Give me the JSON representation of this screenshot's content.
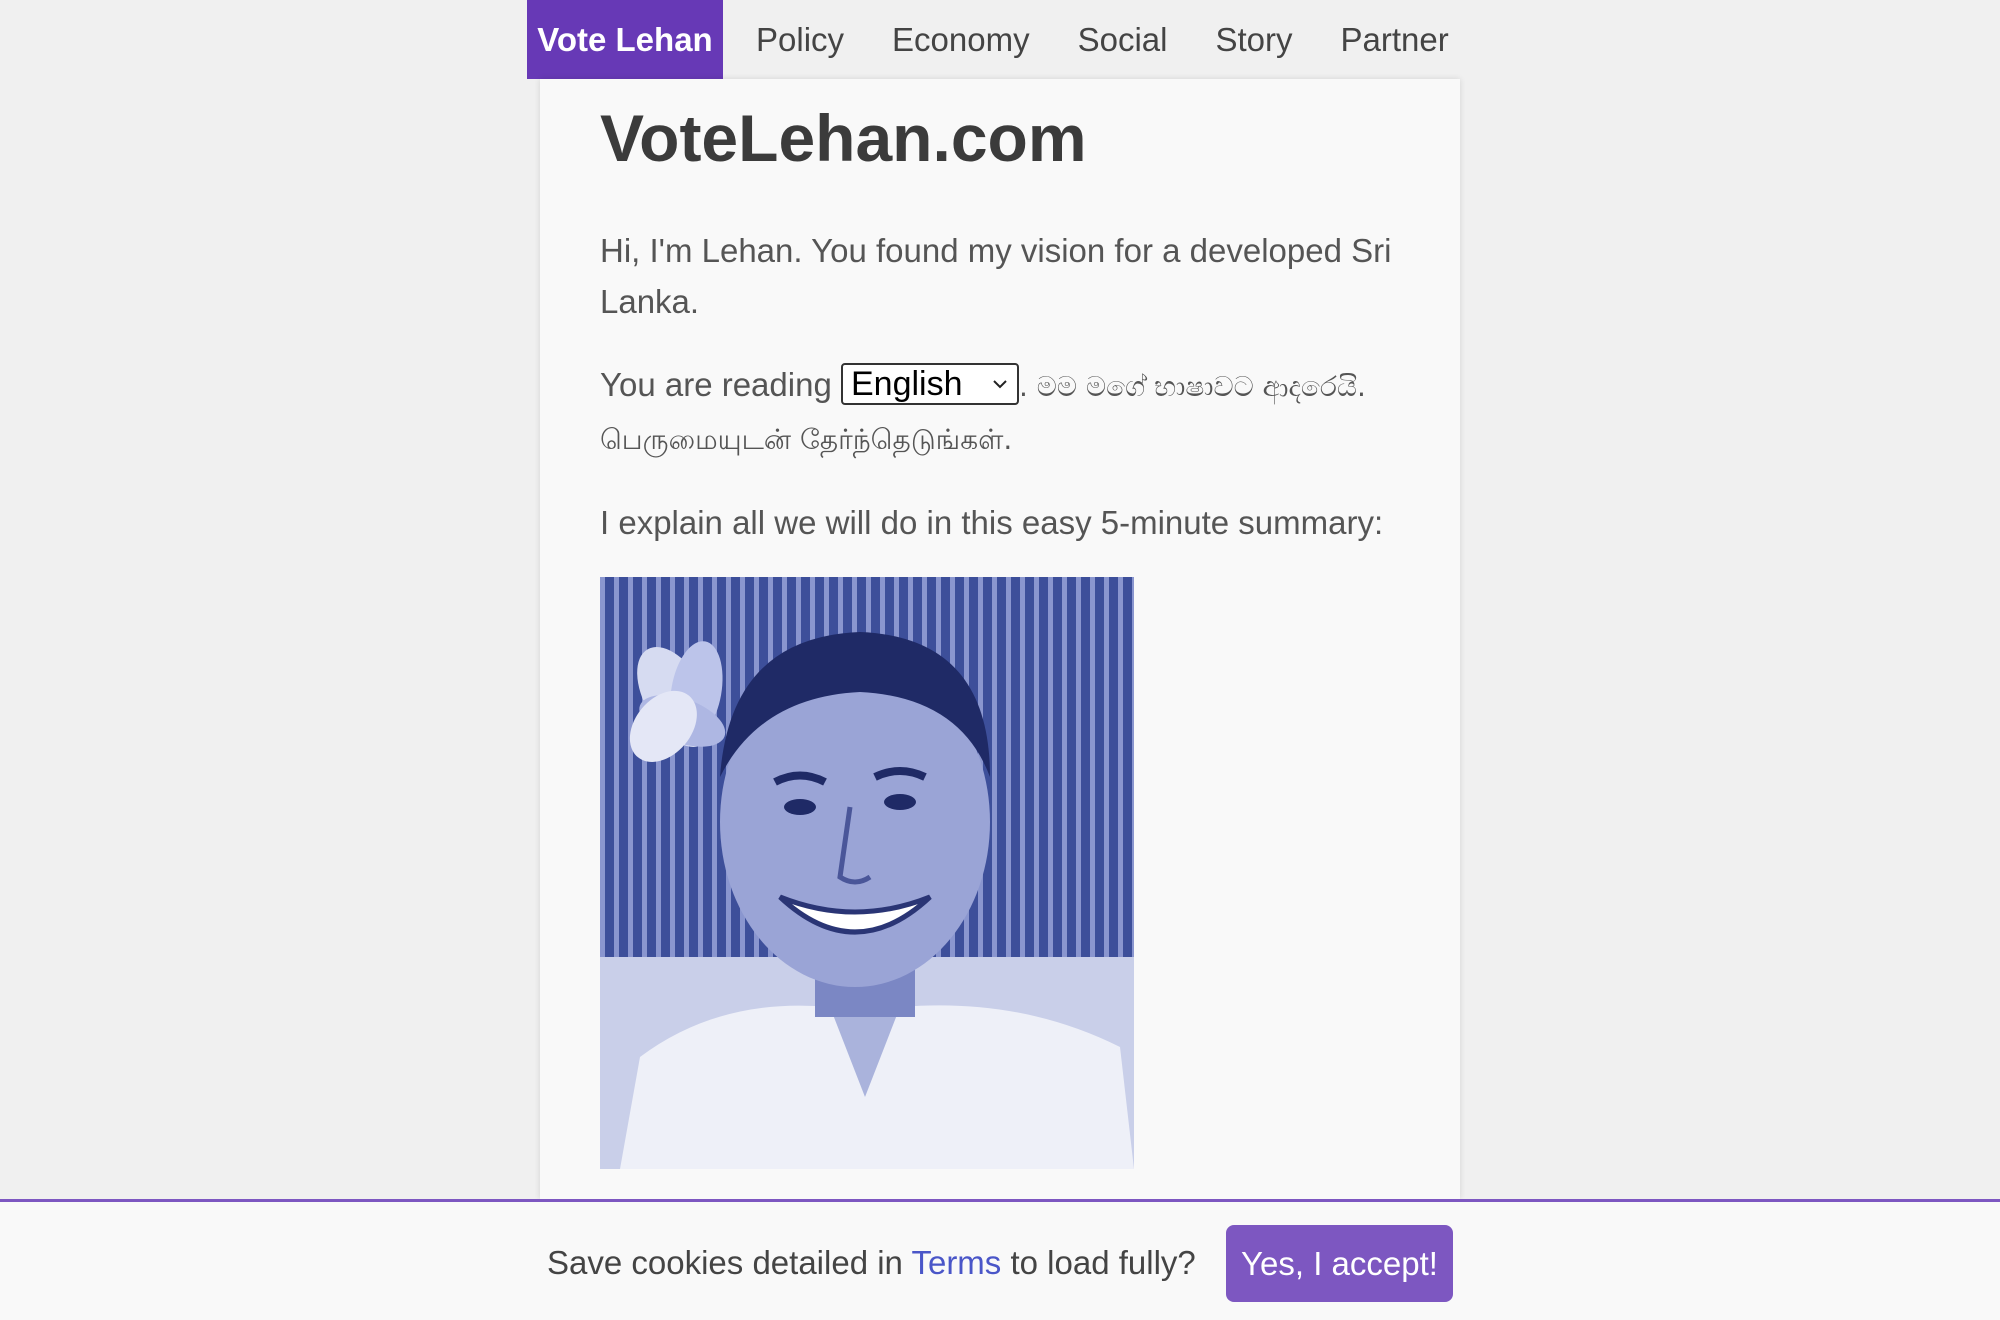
{
  "nav": {
    "brand": "Vote Lehan",
    "items": [
      {
        "label": "Policy"
      },
      {
        "label": "Economy"
      },
      {
        "label": "Social"
      },
      {
        "label": "Story"
      },
      {
        "label": "Partner"
      }
    ]
  },
  "main": {
    "title": "VoteLehan.com",
    "intro": "Hi, I'm Lehan. You found my vision for a developed Sri Lanka.",
    "reading_prefix": "You are reading",
    "language_select": {
      "selected": "English"
    },
    "sinhala_text": ". මම මගේ භාෂාවට ආදරෙයි.",
    "tamil_text": "பெருமையுடன் தேர்ந்தெடுங்கள்.",
    "summary_text": "I explain all we will do in this easy 5-minute summary:"
  },
  "portrait": {
    "icon": "portrait-photo",
    "tint": "#5f6fb6"
  },
  "cookie": {
    "text_before": "Save cookies detailed in ",
    "link_text": "Terms",
    "text_after": " to load fully?",
    "accept_label": "Yes, I accept!"
  },
  "colors": {
    "brand": "#6739b6",
    "accent": "#7d57c1",
    "link": "#4a56c8"
  }
}
